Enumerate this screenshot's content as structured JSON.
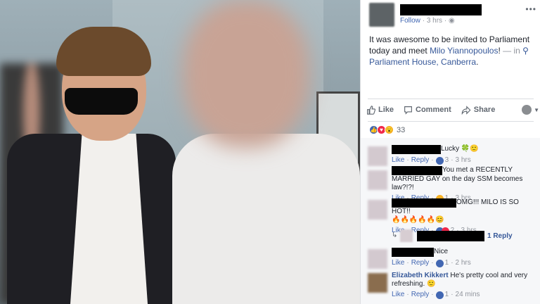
{
  "post": {
    "meta_follow": "Follow",
    "meta_time": "3 hrs",
    "meta_sep": "·",
    "more": "•••",
    "text_prefix": "It was awesome to be invited to Parliament today and meet ",
    "mention": "Milo Yiannopoulos",
    "text_suffix": "! ",
    "in_sep": "— in",
    "location_icon": "pin-icon",
    "location": "Parliament House, Canberra",
    "location_end": "."
  },
  "actions": {
    "like": "Like",
    "comment": "Comment",
    "share": "Share"
  },
  "reactions": {
    "count": "33",
    "types": [
      "like",
      "love",
      "wow"
    ]
  },
  "comments": [
    {
      "text": "Lucky",
      "emoji": "🍀🙂",
      "like": "Like",
      "reply": "Reply",
      "react_count": "3",
      "time": "3 hrs"
    },
    {
      "text": "You met a RECENTLY MARRIED GAY on the day SSM becomes law?!?!",
      "like": "Like",
      "reply": "Reply",
      "react_count": "1",
      "time": "3 hrs"
    },
    {
      "text": "OMG!!! MILO IS SO HOT!!",
      "emoji": "🔥🔥🔥🔥🔥😊",
      "like": "Like",
      "reply": "Reply",
      "react_count": "2",
      "time": "3 hrs",
      "replies_label": "1 Reply"
    },
    {
      "text": "Nice",
      "like": "Like",
      "reply": "Reply",
      "react_count": "1",
      "time": "2 hrs"
    },
    {
      "author": "Elizabeth Kikkert",
      "text": "He's pretty cool and very refreshing.",
      "emoji": "🙂",
      "like": "Like",
      "reply": "Reply",
      "react_count": "1",
      "time": "24 mins"
    }
  ],
  "colors": {
    "link": "#365899",
    "accent": "#4267b2",
    "meta": "#90949c",
    "redaction": "#000000"
  }
}
